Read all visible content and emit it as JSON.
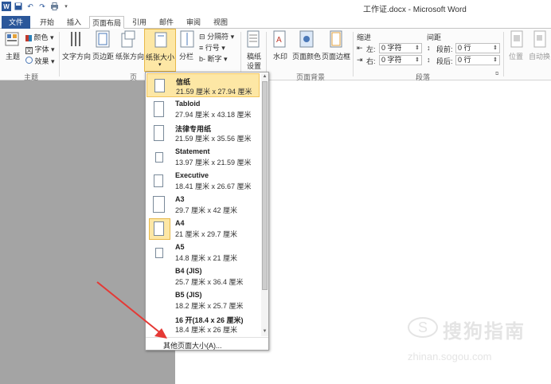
{
  "window": {
    "title": "工作证.docx - Microsoft Word",
    "app_logo": "W"
  },
  "qat": {
    "icons": [
      "word-logo-icon",
      "save-icon",
      "undo-icon",
      "redo-icon",
      "print-icon",
      "customize-icon"
    ]
  },
  "tabs": [
    {
      "label": "文件"
    },
    {
      "label": "开始"
    },
    {
      "label": "插入"
    },
    {
      "label": "页面布局"
    },
    {
      "label": "引用"
    },
    {
      "label": "邮件"
    },
    {
      "label": "审阅"
    },
    {
      "label": "视图"
    }
  ],
  "ribbon": {
    "theme_group": {
      "themes": "主题",
      "colors": "颜色",
      "fonts": "字体",
      "effects": "效果",
      "label": "主题"
    },
    "page_setup": {
      "text_direction": "文字方向",
      "margins": "页边距",
      "orientation": "纸张方向",
      "size": "纸张大小",
      "columns": "分栏",
      "breaks": "分隔符",
      "line_numbers": "行号",
      "hyphenation": "断字",
      "label": "页面设置"
    },
    "draft": {
      "label_line1": "稿纸",
      "label_line2": "设置"
    },
    "page_background": {
      "watermark": "水印",
      "page_color": "页面颜色",
      "page_borders": "页面边框",
      "label": "页面背景"
    },
    "paragraph": {
      "indent_title": "缩进",
      "spacing_title": "间距",
      "left_label": "左:",
      "left_value": "0 字符",
      "right_label": "右:",
      "right_value": "0 字符",
      "before_label": "段前:",
      "before_value": "0 行",
      "after_label": "段后:",
      "after_value": "0 行",
      "label": "段落"
    },
    "arrange": {
      "position": "位置",
      "wrap": "自动换"
    }
  },
  "paper_sizes": {
    "items": [
      {
        "name": "信纸",
        "dims": "21.59 厘米 x 27.94 厘米",
        "highlighted": true
      },
      {
        "name": "Tabloid",
        "dims": "27.94 厘米 x 43.18 厘米"
      },
      {
        "name": "法律专用纸",
        "dims": "21.59 厘米 x 35.56 厘米"
      },
      {
        "name": "Statement",
        "dims": "13.97 厘米 x 21.59 厘米"
      },
      {
        "name": "Executive",
        "dims": "18.41 厘米 x 26.67 厘米"
      },
      {
        "name": "A3",
        "dims": "29.7 厘米 x 42 厘米"
      },
      {
        "name": "A4",
        "dims": "21 厘米 x 29.7 厘米",
        "selected": true
      },
      {
        "name": "A5",
        "dims": "14.8 厘米 x 21 厘米"
      },
      {
        "name": "B4 (JIS)",
        "dims": "25.7 厘米 x 36.4 厘米"
      },
      {
        "name": "B5 (JIS)",
        "dims": "18.2 厘米 x 25.7 厘米"
      },
      {
        "name": "16 开(18.4 x 26 厘米)",
        "dims": "18.4 厘米 x 26 厘米"
      }
    ],
    "more_sizes": "其他页面大小(A)..."
  },
  "watermark": {
    "logo": "S",
    "text": "搜狗指南",
    "url": "zhinan.sogou.com"
  },
  "colors": {
    "accent": "#2b579a",
    "highlight": "#fde7a5",
    "highlight_border": "#e7b84a",
    "arrow": "#e53935"
  }
}
